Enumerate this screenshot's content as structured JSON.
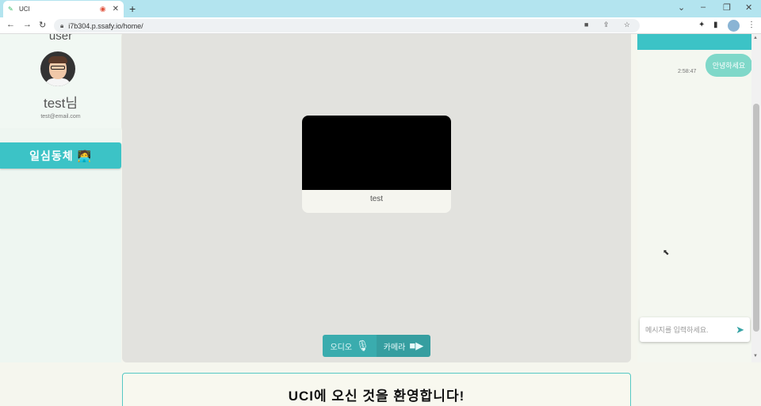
{
  "browser": {
    "tab_title": "UCI",
    "url": "i7b304.p.ssafy.io/home/",
    "new_tab": "+",
    "close_tab": "✕"
  },
  "profile": {
    "role": "user",
    "name": "test님",
    "email": "test@email.com"
  },
  "sidebar": {
    "group_button": "일심동체 🧑‍💻"
  },
  "video": {
    "participant_name": "test"
  },
  "controls": {
    "audio_label": "오디오",
    "camera_label": "카메라"
  },
  "chat": {
    "message_text": "안녕하세요",
    "message_time": "2:58:47",
    "input_placeholder": "메시지를 입력하세요."
  },
  "welcome": {
    "title": "UCI에 오신 것을 환영합니다!"
  },
  "colors": {
    "accent": "#3cc3c6",
    "bubble": "#7fd8c9",
    "control": "#3aacae"
  }
}
